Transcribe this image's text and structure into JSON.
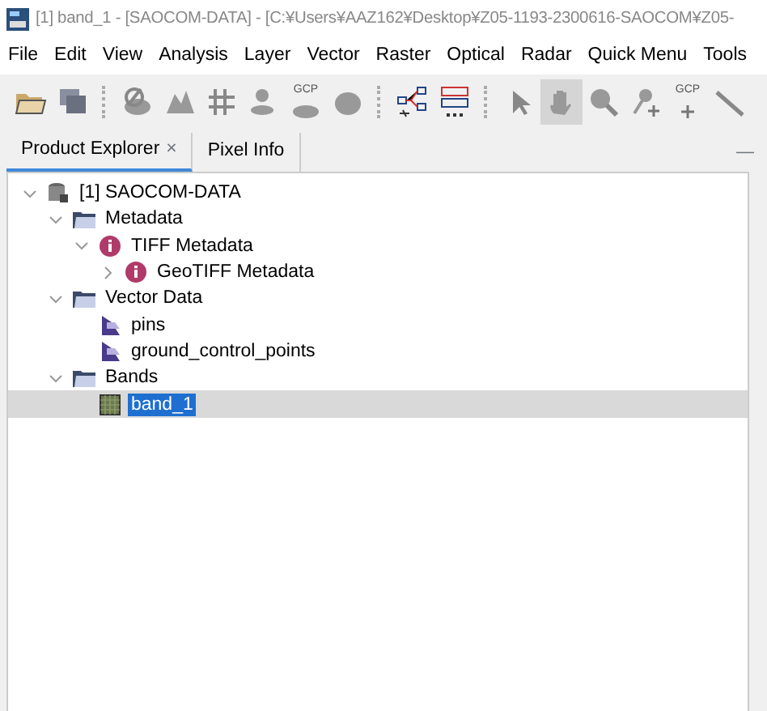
{
  "window": {
    "title": "[1] band_1 - [SAOCOM-DATA] - [C:¥Users¥AAZ162¥Desktop¥Z05-1193-2300616-SAOCOM¥Z05-"
  },
  "menu": [
    "File",
    "Edit",
    "View",
    "Analysis",
    "Layer",
    "Vector",
    "Raster",
    "Optical",
    "Radar",
    "Quick Menu",
    "Tools"
  ],
  "toolbar": [
    {
      "kind": "open",
      "selected": false
    },
    {
      "kind": "save",
      "selected": false
    },
    {
      "kind": "sep"
    },
    {
      "kind": "noblob",
      "selected": false
    },
    {
      "kind": "blobs",
      "selected": false
    },
    {
      "kind": "grid",
      "selected": false
    },
    {
      "kind": "pin",
      "selected": false
    },
    {
      "kind": "gcpblob",
      "label": "GCP",
      "selected": false
    },
    {
      "kind": "blob",
      "selected": false
    },
    {
      "kind": "sep"
    },
    {
      "kind": "graph",
      "selected": false
    },
    {
      "kind": "batch",
      "selected": false
    },
    {
      "kind": "sep"
    },
    {
      "kind": "pointer",
      "selected": false
    },
    {
      "kind": "hand",
      "selected": true
    },
    {
      "kind": "zoom",
      "selected": false
    },
    {
      "kind": "pinadd",
      "selected": false
    },
    {
      "kind": "gcpadd",
      "label": "GCP",
      "selected": false
    },
    {
      "kind": "line",
      "selected": false
    }
  ],
  "tabs": [
    {
      "label": "Product Explorer",
      "close": "×",
      "selected": true
    },
    {
      "label": "Pixel Info",
      "selected": false
    }
  ],
  "panel": {
    "minimize": "—"
  },
  "tree": [
    {
      "label": "[1] SAOCOM-DATA",
      "kind": "product",
      "expanded": true,
      "selected": false,
      "children": [
        {
          "label": "Metadata",
          "kind": "folder",
          "expanded": true,
          "selected": false,
          "children": [
            {
              "label": "TIFF Metadata",
              "kind": "info",
              "expanded": true,
              "selected": false,
              "children": [
                {
                  "label": "GeoTIFF Metadata",
                  "kind": "info",
                  "expanded": false,
                  "selected": false
                }
              ]
            }
          ]
        },
        {
          "label": "Vector Data",
          "kind": "folder",
          "expanded": true,
          "selected": false,
          "children": [
            {
              "label": "pins",
              "kind": "vector",
              "selected": false
            },
            {
              "label": "ground_control_points",
              "kind": "vector",
              "selected": false
            }
          ]
        },
        {
          "label": "Bands",
          "kind": "folder",
          "expanded": true,
          "selected": false,
          "children": [
            {
              "label": "band_1",
              "kind": "band",
              "selected": true
            }
          ]
        }
      ]
    }
  ]
}
